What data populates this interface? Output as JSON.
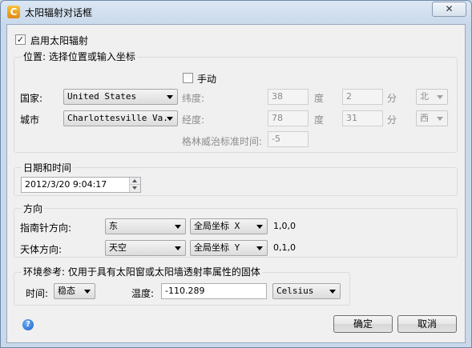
{
  "window": {
    "title": "太阳辐射对话框",
    "close_symbol": "✕",
    "app_icon_glyph": "C"
  },
  "enable_solar": {
    "label": "启用太阳辐射",
    "checked": true,
    "check_glyph": "✓"
  },
  "location": {
    "group_label": "位置: 选择位置或输入坐标",
    "manual": {
      "label": "手动",
      "checked": false
    },
    "country_label": "国家:",
    "country_value": "United States",
    "city_label": "城市",
    "city_value": "Charlottesville Va.",
    "latitude_label": "纬度:",
    "latitude_deg": "38",
    "deg_unit": "度",
    "latitude_min": "2",
    "min_unit": "分",
    "latitude_dir": "北",
    "longitude_label": "经度:",
    "longitude_deg": "78",
    "longitude_min": "31",
    "longitude_dir": "西",
    "gmt_label": "格林威治标准时间:",
    "gmt_value": "-5"
  },
  "datetime": {
    "group_label": "日期和时间",
    "value": "2012/3/20 9:04:17"
  },
  "direction": {
    "group_label": "方向",
    "compass_label": "指南针方向:",
    "compass_value": "东",
    "compass_coord": "全局坐标 X",
    "compass_vector": "1,0,0",
    "sky_label": "天体方向:",
    "sky_value": "天空",
    "sky_coord": "全局坐标 Y",
    "sky_vector": "0,1,0"
  },
  "environment": {
    "group_label": "环境参考: 仅用于具有太阳窗或太阳墙透射率属性的固体",
    "time_label": "时间:",
    "time_value": "稳态",
    "temp_label": "温度:",
    "temp_value": "-110.289",
    "temp_unit": "Celsius"
  },
  "buttons": {
    "ok": "确定",
    "cancel": "取消",
    "help_glyph": "?"
  }
}
